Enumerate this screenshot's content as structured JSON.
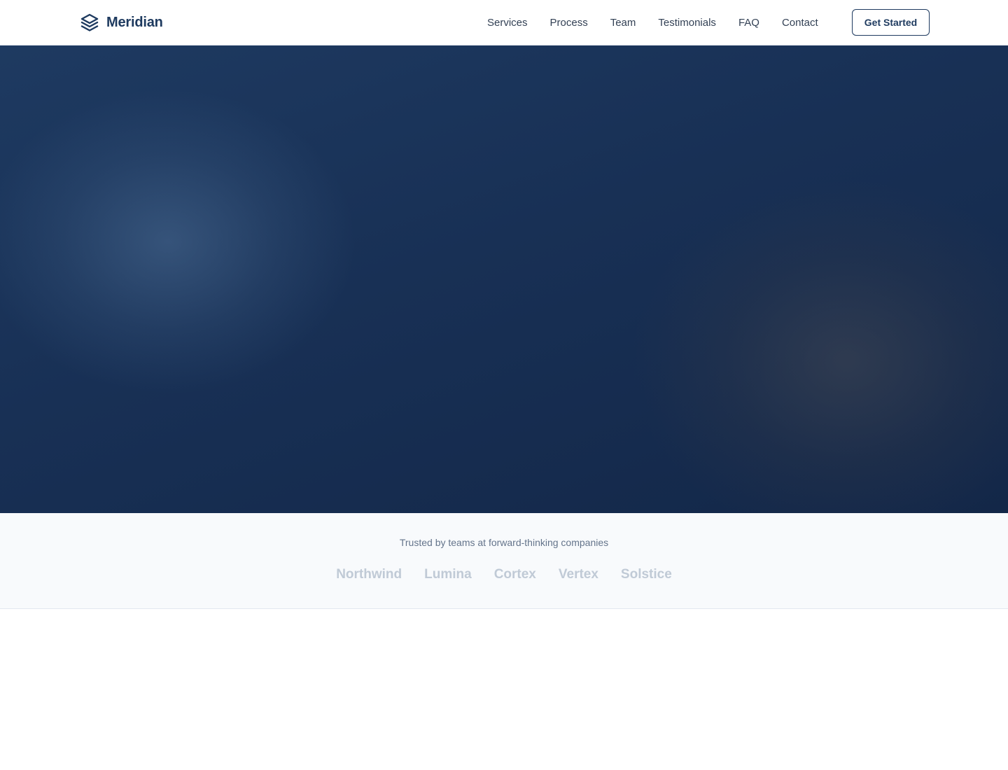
{
  "header": {
    "brand": "Meridian",
    "nav": [
      {
        "label": "Services"
      },
      {
        "label": "Process"
      },
      {
        "label": "Team"
      },
      {
        "label": "Testimonials"
      },
      {
        "label": "FAQ"
      },
      {
        "label": "Contact"
      }
    ],
    "cta_label": "Get Started",
    "logo_icon": "layers-icon"
  },
  "trusted": {
    "caption": "Trusted by teams at forward-thinking companies",
    "companies": [
      "Northwind",
      "Lumina",
      "Cortex",
      "Vertex",
      "Solstice"
    ]
  },
  "colors": {
    "brand": "#1e3a5f",
    "hero_bg": "#183055",
    "trusted_bg": "#f8fafc",
    "logo_muted": "#c0cad6"
  }
}
